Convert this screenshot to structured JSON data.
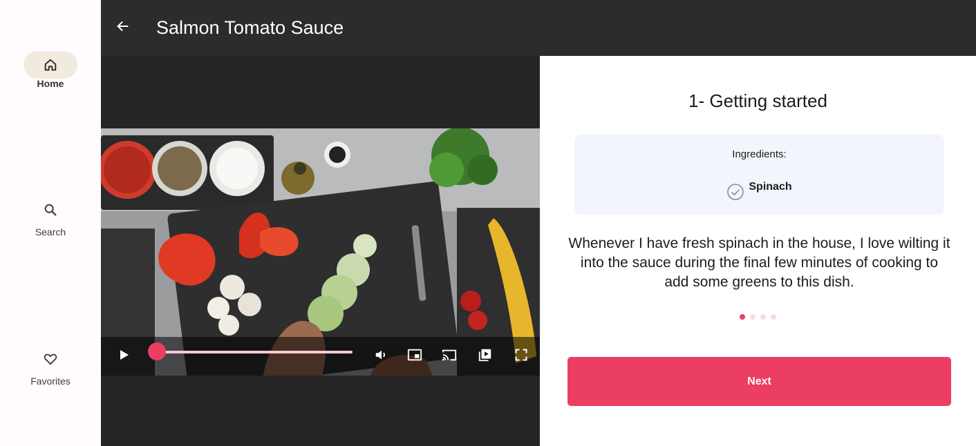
{
  "nav_rail": {
    "items": [
      {
        "label": "Home",
        "icon": "home-icon",
        "selected": true
      },
      {
        "label": "Search",
        "icon": "search-icon",
        "selected": false
      },
      {
        "label": "Favorites",
        "icon": "heart-icon",
        "selected": false
      }
    ]
  },
  "app_bar": {
    "title": "Salmon Tomato Sauce",
    "back_icon": "arrow-back-icon"
  },
  "video_player": {
    "progress": 0.0,
    "controls": [
      "play-icon",
      "volume-icon",
      "picture-in-picture-icon",
      "cast-icon",
      "playlist-icon",
      "fullscreen-icon"
    ]
  },
  "step": {
    "title": "1- Getting started",
    "ingredients_heading": "Ingredients:",
    "ingredients": [
      {
        "name": "Spinach",
        "checked": false
      }
    ],
    "description": "Whenever I have fresh spinach in the house, I love wilting it into the sauce during the final few minutes of cooking to add some greens to this dish.",
    "page_count": 4,
    "current_page": 1,
    "next_label": "Next"
  },
  "colors": {
    "accent": "#ec3d63",
    "app_bar_bg": "#2c2c2c",
    "video_bg": "#252525",
    "ingredient_card_bg": "#f2f5fb",
    "rail_indicator": "#f1eadf"
  }
}
